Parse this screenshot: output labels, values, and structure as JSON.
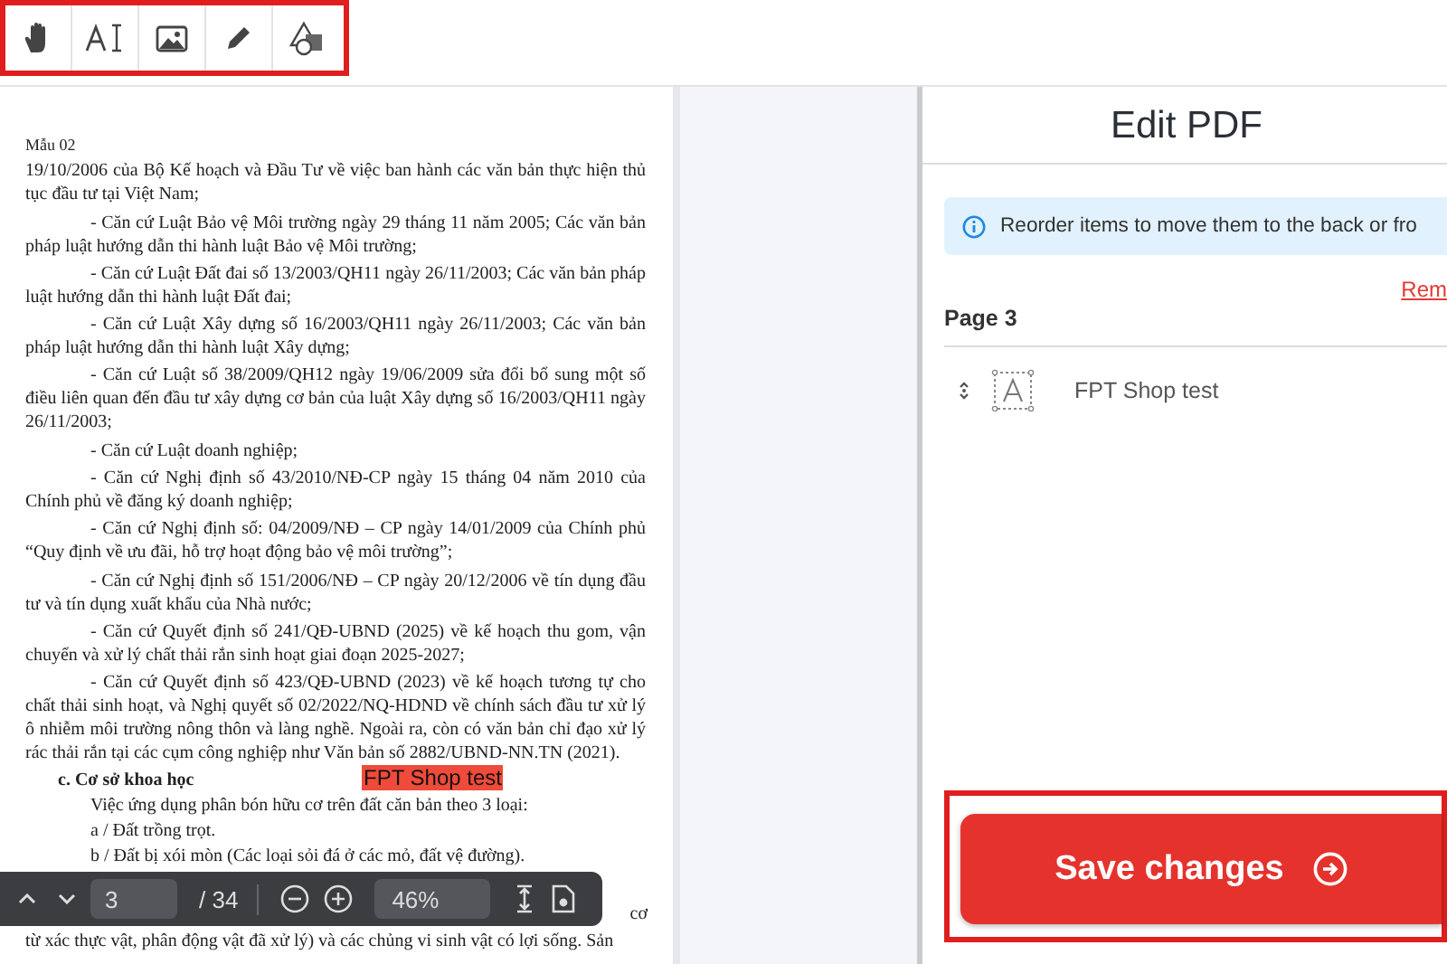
{
  "document": {
    "header": "Mẫu 02",
    "paragraphs": [
      {
        "kind": "plain",
        "text": "19/10/2006 của Bộ Kế hoạch và Đầu Tư về việc ban hành các văn bản thực hiện thủ tục đầu tư tại Việt Nam;"
      },
      {
        "kind": "indent",
        "text": "- Căn cứ Luật Bảo vệ Môi trường ngày 29 tháng 11 năm 2005; Các văn bản pháp luật hướng dẫn thi hành luật Bảo vệ Môi trường;"
      },
      {
        "kind": "indent",
        "text": "- Căn cứ Luật Đất đai số 13/2003/QH11 ngày 26/11/2003; Các văn bản pháp luật hướng dẫn thi hành luật Đất đai;"
      },
      {
        "kind": "indent",
        "text": "- Căn cứ Luật Xây dựng số 16/2003/QH11 ngày 26/11/2003; Các văn bản pháp luật hướng dẫn thi hành luật Xây dựng;"
      },
      {
        "kind": "indent",
        "text": "- Căn cứ Luật số 38/2009/QH12 ngày 19/06/2009 sửa đổi bổ sung một số điều liên quan đến đầu tư xây dựng cơ bản của luật Xây dựng số 16/2003/QH11 ngày 26/11/2003;"
      },
      {
        "kind": "indent",
        "text": "- Căn cứ Luật doanh nghiệp;"
      },
      {
        "kind": "indent",
        "text": "- Căn cứ Nghị định số 43/2010/NĐ-CP ngày 15 tháng 04 năm 2010 của Chính phủ về đăng ký doanh nghiệp;"
      },
      {
        "kind": "indent",
        "text": "- Căn cứ Nghị định số: 04/2009/NĐ – CP ngày 14/01/2009 của Chính phủ “Quy định về ưu đãi, hỗ trợ hoạt động bảo vệ môi trường”;"
      },
      {
        "kind": "indent",
        "text": "- Căn cứ Nghị định số 151/2006/NĐ – CP ngày 20/12/2006 về tín dụng đầu tư và tín dụng xuất khẩu của Nhà nước;"
      },
      {
        "kind": "indent",
        "text": "- Căn cứ Quyết định số 241/QĐ-UBND (2025) về kế hoạch thu gom, vận chuyển và xử lý chất thải rắn sinh hoạt giai đoạn 2025-2027;"
      },
      {
        "kind": "indent",
        "text": "- Căn cứ Quyết định số 423/QĐ-UBND (2023) về kế hoạch tương tự cho chất thải sinh hoạt, và Nghị quyết số 02/2022/NQ-HDND về chính sách đầu tư xử lý ô nhiễm môi trường nông thôn và làng nghề. Ngoài ra, còn có văn bản chỉ đạo xử lý rác thải rắn tại các cụm công nghiệp như Văn bản số 2882/UBND-NN.TN (2021)."
      },
      {
        "kind": "heading",
        "text": "c. Cơ sở khoa học"
      },
      {
        "kind": "indent",
        "text": "Việc ứng dụng phân bón hữu cơ trên đất căn bản theo 3 loại:"
      },
      {
        "kind": "indent",
        "text": "a / Đất trồng trọt."
      },
      {
        "kind": "indent",
        "text": "b / Đất bị xói mòn (Các loại sỏi đá ở các mỏ, đất vệ đường)."
      },
      {
        "kind": "end",
        "text": "cơ"
      },
      {
        "kind": "plain",
        "text": "từ xác thực vật, phân động vật đã xử lý) và các chủng vi sinh vật có lợi sống. Sản"
      }
    ],
    "annotation": "FPT Shop test"
  },
  "viewer_controls": {
    "page": "3",
    "total": "/ 34",
    "zoom": "46%"
  },
  "panel": {
    "title": "Edit PDF",
    "info": "Reorder items to move them to the back or fro",
    "remove_link": "Rem",
    "page_heading": "Page 3",
    "items": [
      {
        "kind": "text",
        "label": "FPT Shop test"
      }
    ],
    "save_button": "Save changes"
  }
}
